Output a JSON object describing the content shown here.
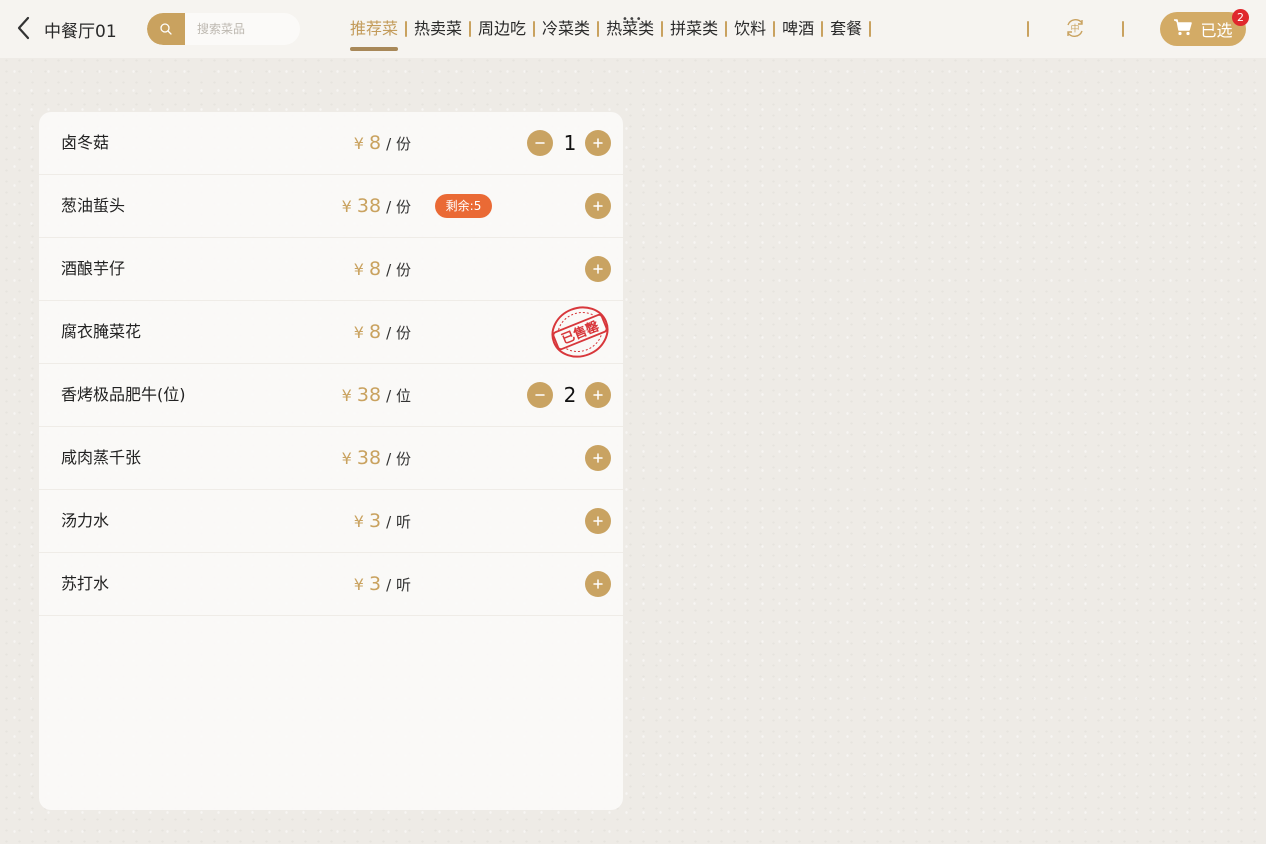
{
  "header": {
    "back_icon": "chevron-left-icon",
    "hall_name": "中餐厅01",
    "search": {
      "placeholder": "搜索菜品",
      "value": "",
      "icon": "search-icon"
    },
    "tabs": [
      {
        "label": "推荐菜",
        "active": true
      },
      {
        "label": "热卖菜"
      },
      {
        "label": "周边吃"
      },
      {
        "label": "冷菜类"
      },
      {
        "label": "热菜类"
      },
      {
        "label": "拼菜类"
      },
      {
        "label": "饮料"
      },
      {
        "label": "啤酒"
      },
      {
        "label": "套餐"
      }
    ],
    "more_indicator": "•••",
    "language_icon": "language-switch-icon",
    "language_glyph": "中",
    "cart": {
      "label": "已选",
      "count": "2",
      "icon": "cart-icon"
    }
  },
  "dishes": [
    {
      "name": "卤冬菇",
      "currency": "¥",
      "price": "8",
      "unit": "/ 份",
      "quantity": "1"
    },
    {
      "name": "葱油蜇头",
      "currency": "¥",
      "price": "38",
      "unit": "/ 份",
      "stock_badge": "剩余:5"
    },
    {
      "name": "酒酿芋仔",
      "currency": "¥",
      "price": "8",
      "unit": "/ 份"
    },
    {
      "name": "腐衣腌菜花",
      "currency": "¥",
      "price": "8",
      "unit": "/ 份",
      "sold_out_stamp": "已售罄"
    },
    {
      "name": "香烤极品肥牛(位)",
      "currency": "¥",
      "price": "38",
      "unit": "/ 位",
      "quantity": "2"
    },
    {
      "name": "咸肉蒸千张",
      "currency": "¥",
      "price": "38",
      "unit": "/ 份"
    },
    {
      "name": "汤力水",
      "currency": "¥",
      "price": "3",
      "unit": "/ 听"
    },
    {
      "name": "苏打水",
      "currency": "¥",
      "price": "3",
      "unit": "/ 听"
    }
  ],
  "colors": {
    "accent": "#c9a25f",
    "active_tab": "#c39b5a",
    "stock_badge": "#ea6a35",
    "cart_badge": "#e0282d",
    "sold_out_stamp": "#d8373b"
  }
}
